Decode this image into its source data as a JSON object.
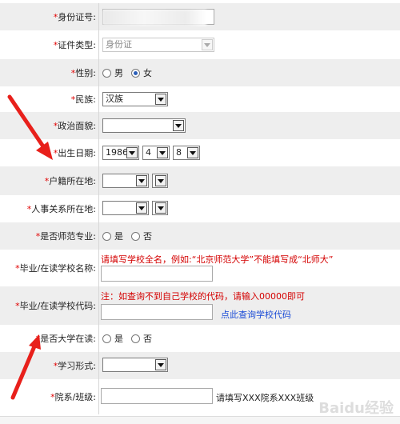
{
  "form": {
    "id_number": {
      "label": "身份证号:",
      "value": ""
    },
    "id_type": {
      "label": "证件类型:",
      "selected": "身份证"
    },
    "gender": {
      "label": "性别:",
      "options": [
        "男",
        "女"
      ],
      "selected": "女"
    },
    "ethnicity": {
      "label": "民族:",
      "selected": "汉族"
    },
    "political_status": {
      "label": "政治面貌:",
      "selected": ""
    },
    "birth_date": {
      "label": "出生日期:",
      "year": "1986",
      "month": "4",
      "day": "8"
    },
    "hukou_location": {
      "label": "户籍所在地:",
      "province": "",
      "city": ""
    },
    "personnel_location": {
      "label": "人事关系所在地:",
      "province": "",
      "city": ""
    },
    "normal_major": {
      "label": "是否师范专业:",
      "options": [
        "是",
        "否"
      ]
    },
    "school_name": {
      "label": "毕业/在读学校名称:",
      "note": "请填写学校全名，例如:“北京师范大学”不能填写成“北师大”",
      "value": ""
    },
    "school_code": {
      "label": "毕业/在读学校代码:",
      "note": "注：如查询不到自己学校的代码，请输入00000即可",
      "value": "",
      "link_text": "点此查询学校代码"
    },
    "is_student": {
      "label": "是否大学在读:",
      "options": [
        "是",
        "否"
      ]
    },
    "study_form": {
      "label": "学习形式:",
      "selected": ""
    },
    "department_class": {
      "label": "院系/班级:",
      "value": "",
      "hint": "请填写XXX院系XXX班级"
    }
  },
  "watermark": "Baidu经验",
  "colors": {
    "required": "#e10000",
    "note": "#d40000",
    "link": "#1a4bd6",
    "arrow": "#e8201b",
    "row_shade": "#eeeeee"
  }
}
